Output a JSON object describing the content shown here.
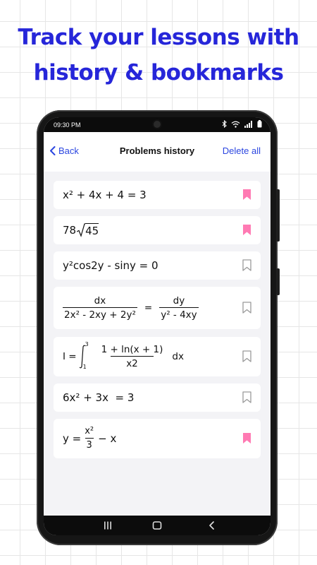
{
  "headline": {
    "line1": "Track your lessons with",
    "line2": "history & bookmarks"
  },
  "status": {
    "time": "09:30 PM",
    "icons": [
      "bluetooth-icon",
      "wifi-icon",
      "signal-icon",
      "battery-icon"
    ]
  },
  "appbar": {
    "back_label": "Back",
    "title": "Problems history",
    "delete_all_label": "Delete all"
  },
  "colors": {
    "headline": "#2626d9",
    "accent": "#2b46e0",
    "bookmark_on": "#ff7ab3",
    "bookmark_off": "#9a9a9a"
  },
  "problems": [
    {
      "parts": {
        "a": "x² + 4x + 4 = 3"
      },
      "bookmarked": true
    },
    {
      "parts": {
        "a": "78",
        "b": "45"
      },
      "bookmarked": true
    },
    {
      "parts": {
        "a": "y²cos2y - siny = 0"
      },
      "bookmarked": false
    },
    {
      "parts": {
        "n1": "dx",
        "d1": "2x² - 2xy + 2y²",
        "eq": "=",
        "n2": "dy",
        "d2": "y² - 4xy"
      },
      "bookmarked": false
    },
    {
      "parts": {
        "pre": "I =",
        "upper": "3",
        "lower": "1",
        "num": "1 + ln(x + 1)",
        "den": "x2",
        "post": "dx"
      },
      "bookmarked": false
    },
    {
      "parts": {
        "a": "6x² + 3x  = 3"
      },
      "bookmarked": false
    },
    {
      "parts": {
        "pre": "y =",
        "num": "x²",
        "den": "3",
        "post": "− x"
      },
      "bookmarked": true
    }
  ],
  "nav": {
    "icons": [
      "recents-icon",
      "home-icon",
      "back-nav-icon"
    ]
  }
}
